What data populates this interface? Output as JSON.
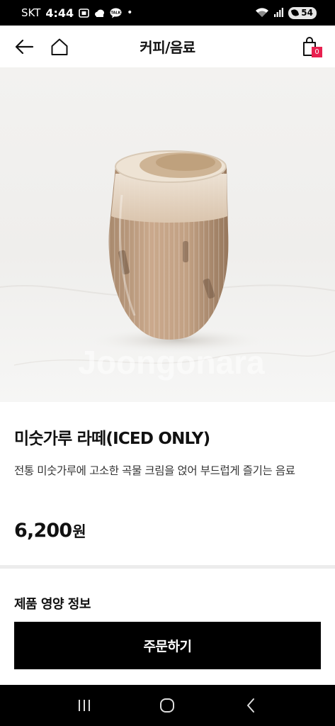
{
  "status_bar": {
    "carrier": "SKT",
    "time": "4:44",
    "notification_icons": [
      "screenshot-icon",
      "cloud-icon",
      "talk-icon"
    ],
    "talk_label": "TALK",
    "dot": "•",
    "battery": "54"
  },
  "header": {
    "title": "커피/음료",
    "cart_count": "0"
  },
  "hero": {
    "watermark": "Joongonara"
  },
  "product": {
    "name": "미숫가루 라떼(ICED ONLY)",
    "description": " 전통 미숫가루에 고소한 곡물 크림을 얹어 부드럽게 즐기는 음료",
    "price": "6,200",
    "currency": "원"
  },
  "nutrition": {
    "title": "제품 영양 정보"
  },
  "order": {
    "button_label": "주문하기"
  },
  "colors": {
    "accent": "#e8204f",
    "button": "#000000"
  }
}
